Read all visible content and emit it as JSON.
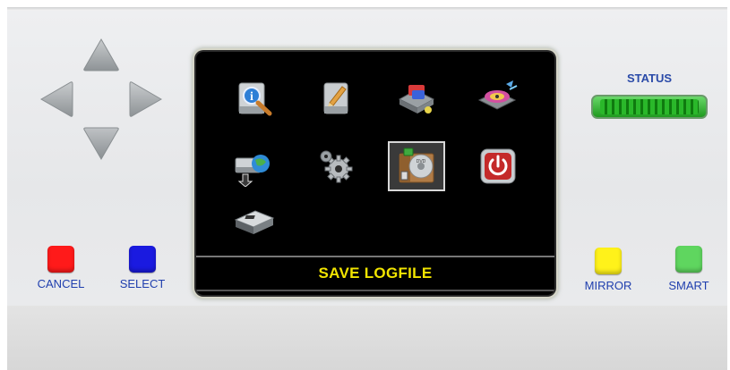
{
  "dpad": {
    "up_icon": "arrow-up-icon",
    "down_icon": "arrow-down-icon",
    "left_icon": "arrow-left-icon",
    "right_icon": "arrow-right-icon"
  },
  "screen": {
    "icons": [
      {
        "name": "info-search-icon"
      },
      {
        "name": "edit-disk-icon"
      },
      {
        "name": "network-drive-icon"
      },
      {
        "name": "disk-sync-icon"
      },
      {
        "name": "globe-transfer-icon"
      },
      {
        "name": "settings-gears-icon"
      },
      {
        "name": "save-logfile-icon",
        "selected": true
      },
      {
        "name": "power-icon"
      },
      {
        "name": "device-icon"
      }
    ],
    "selected_label": "SAVE LOGFILE"
  },
  "buttons": {
    "cancel": {
      "label": "CANCEL",
      "color": "#ff0000"
    },
    "select": {
      "label": "SELECT",
      "color": "#1a1adc"
    },
    "mirror": {
      "label": "MIRROR",
      "color": "#ffee00"
    },
    "smart": {
      "label": "SMART",
      "color": "#5ed35e"
    }
  },
  "status": {
    "label": "STATUS",
    "led_color": "#22b022"
  },
  "colors": {
    "label_blue": "#1f3fae",
    "screen_label_yellow": "#f1e400"
  }
}
